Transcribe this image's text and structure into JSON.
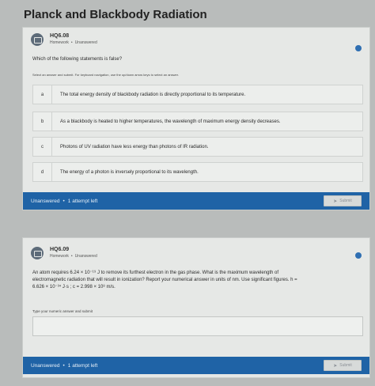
{
  "page": {
    "title": "Planck and Blackbody Radiation"
  },
  "questions": [
    {
      "id": "HQ6.08",
      "type": "Homework",
      "status": "Unanswered",
      "text": "Which of the following statements is false?",
      "instructions": "Select an answer and submit. For keyboard navigation, use the up/down arrow keys to select an answer.",
      "options": [
        {
          "letter": "a",
          "text": "The total energy density of blackbody radiation is directly proportional to its temperature."
        },
        {
          "letter": "b",
          "text": "As a blackbody is heated to higher temperatures, the wavelength of maximum energy density decreases."
        },
        {
          "letter": "c",
          "text": "Photons of UV radiation have less energy than photons of IR radiation."
        },
        {
          "letter": "d",
          "text": "The energy of a photon is inversely proportional to its wavelength."
        }
      ],
      "footer": {
        "status": "Unanswered",
        "attempts": "1 attempt left",
        "submit_label": "Submit"
      }
    },
    {
      "id": "HQ6.09",
      "type": "Homework",
      "status": "Unanswered",
      "text_line1": "An atom requires 6.24 × 10⁻¹⁹ J to remove its furthest electron in the gas phase. What is the maximum wavelength of",
      "text_line2": "electromagnetic radiation that will result in ionization? Report your numerical answer in units of nm. Use significant figures. h =",
      "text_line3": "6.626 × 10⁻³⁴ J·s ; c = 2.998 × 10⁸ m/s.",
      "answer_label": "Type your numeric answer and submit",
      "answer_value": "",
      "footer": {
        "status": "Unanswered",
        "attempts": "1 attempt left",
        "submit_label": "Submit"
      }
    }
  ],
  "colors": {
    "accent": "#1f63a6",
    "background": "#b9bcbb",
    "card": "#e6e8e6"
  }
}
